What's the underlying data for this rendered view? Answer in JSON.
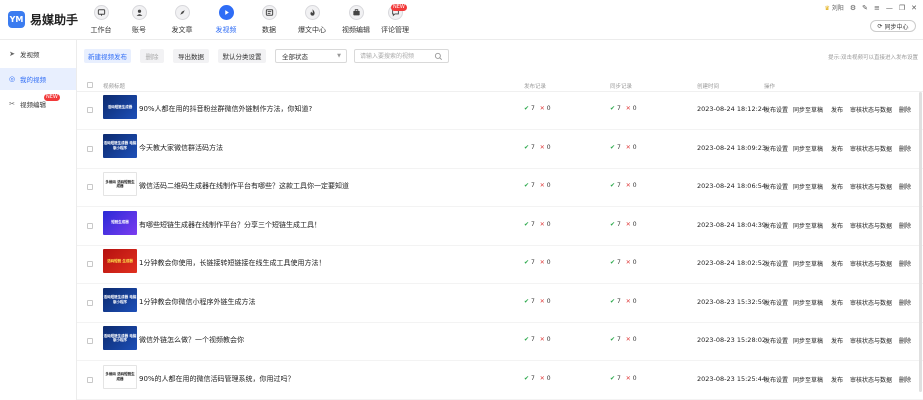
{
  "app": {
    "logo_text": "YM",
    "name": "易媒助手"
  },
  "nav": [
    {
      "label": "工作台",
      "icon": "monitor-icon"
    },
    {
      "label": "账号",
      "icon": "user-icon"
    },
    {
      "label": "发文章",
      "icon": "compass-icon"
    },
    {
      "label": "发视频",
      "icon": "play-icon"
    },
    {
      "label": "数据",
      "icon": "chart-icon"
    },
    {
      "label": "爆文中心",
      "icon": "flame-icon"
    },
    {
      "label": "视频编辑",
      "icon": "briefcase-icon"
    },
    {
      "label": "评论管理",
      "icon": "comment-icon",
      "badge": "NEW"
    }
  ],
  "window": {
    "user_name": "刘阳",
    "sync_label": "同步中心"
  },
  "sidebar": [
    {
      "label": "发视频",
      "icon": "send-icon"
    },
    {
      "label": "我的视频",
      "icon": "video-icon"
    },
    {
      "label": "视频编辑",
      "icon": "edit-icon",
      "badge": "NEW"
    }
  ],
  "toolbar": {
    "new_label": "新建视频发布",
    "delete_label": "删除",
    "export_label": "导出数据",
    "category_label": "默认分类设置",
    "status_value": "全部状态",
    "search_placeholder": "请输入要搜索的视频",
    "hint": "提示:双击视频可以直接进入发布设置"
  },
  "table": {
    "headers": {
      "title": "视频标题",
      "publish": "发布记录",
      "sync": "同步记录",
      "time": "创建时间",
      "ops": "操作"
    },
    "actions": [
      "发布设置",
      "同步至草稿",
      "发布",
      "审核状态与数据",
      "删除"
    ],
    "rows": [
      {
        "title": "90%人都在用的抖音粉丝群微信外链制作方法，你知道?",
        "pub_ok": "7",
        "pub_fail": "0",
        "sync_ok": "7",
        "sync_fail": "0",
        "time": "2023-08-24 18:12:24",
        "thumb": {
          "style": "blue",
          "text": "活码短链生成器"
        }
      },
      {
        "title": "今天教大家微信群活码方法",
        "pub_ok": "7",
        "pub_fail": "0",
        "sync_ok": "7",
        "sync_fail": "0",
        "time": "2023-08-24 18:09:23",
        "thumb": {
          "style": "blue",
          "text": "活码短链生成器 电脑版小程序"
        }
      },
      {
        "title": "微信活码二维码生成器在线制作平台有哪些？这款工具你一定要知道",
        "pub_ok": "7",
        "pub_fail": "0",
        "sync_ok": "7",
        "sync_fail": "0",
        "time": "2023-08-24 18:06:54",
        "thumb": {
          "style": "white",
          "text": "多维码 活码短链生成器"
        }
      },
      {
        "title": "有哪些短链生成器在线制作平台？分享三个短链生成工具！",
        "pub_ok": "7",
        "pub_fail": "0",
        "sync_ok": "7",
        "sync_fail": "0",
        "time": "2023-08-24 18:04:39",
        "thumb": {
          "style": "purple",
          "text": "短链生成器"
        }
      },
      {
        "title": "1分钟教会你使用，长链接转短链接在线生成工具使用方法！",
        "pub_ok": "7",
        "pub_fail": "0",
        "sync_ok": "7",
        "sync_fail": "0",
        "time": "2023-08-24 18:02:52",
        "thumb": {
          "style": "red",
          "text": "活码短链 生成器"
        }
      },
      {
        "title": "1分钟教会你微信小程序外链生成方法",
        "pub_ok": "7",
        "pub_fail": "0",
        "sync_ok": "7",
        "sync_fail": "0",
        "time": "2023-08-23 15:32:59",
        "thumb": {
          "style": "blue",
          "text": "活码短链生成器 电脑版小程序"
        }
      },
      {
        "title": "微信外链怎么做？一个视频教会你",
        "pub_ok": "7",
        "pub_fail": "0",
        "sync_ok": "7",
        "sync_fail": "0",
        "time": "2023-08-23 15:28:02",
        "thumb": {
          "style": "blue",
          "text": "活码短链生成器 电脑版小程序"
        }
      },
      {
        "title": "90%的人都在用的微信活码管理系统，你用过吗？",
        "pub_ok": "7",
        "pub_fail": "0",
        "sync_ok": "7",
        "sync_fail": "0",
        "time": "2023-08-23 15:25:44",
        "thumb": {
          "style": "white",
          "text": "多维码 活码短链生成器"
        }
      }
    ]
  },
  "colors": {
    "accent": "#2f6df6",
    "ok": "#2aa84a",
    "fail": "#e04040",
    "badge": "#f23a3a"
  }
}
